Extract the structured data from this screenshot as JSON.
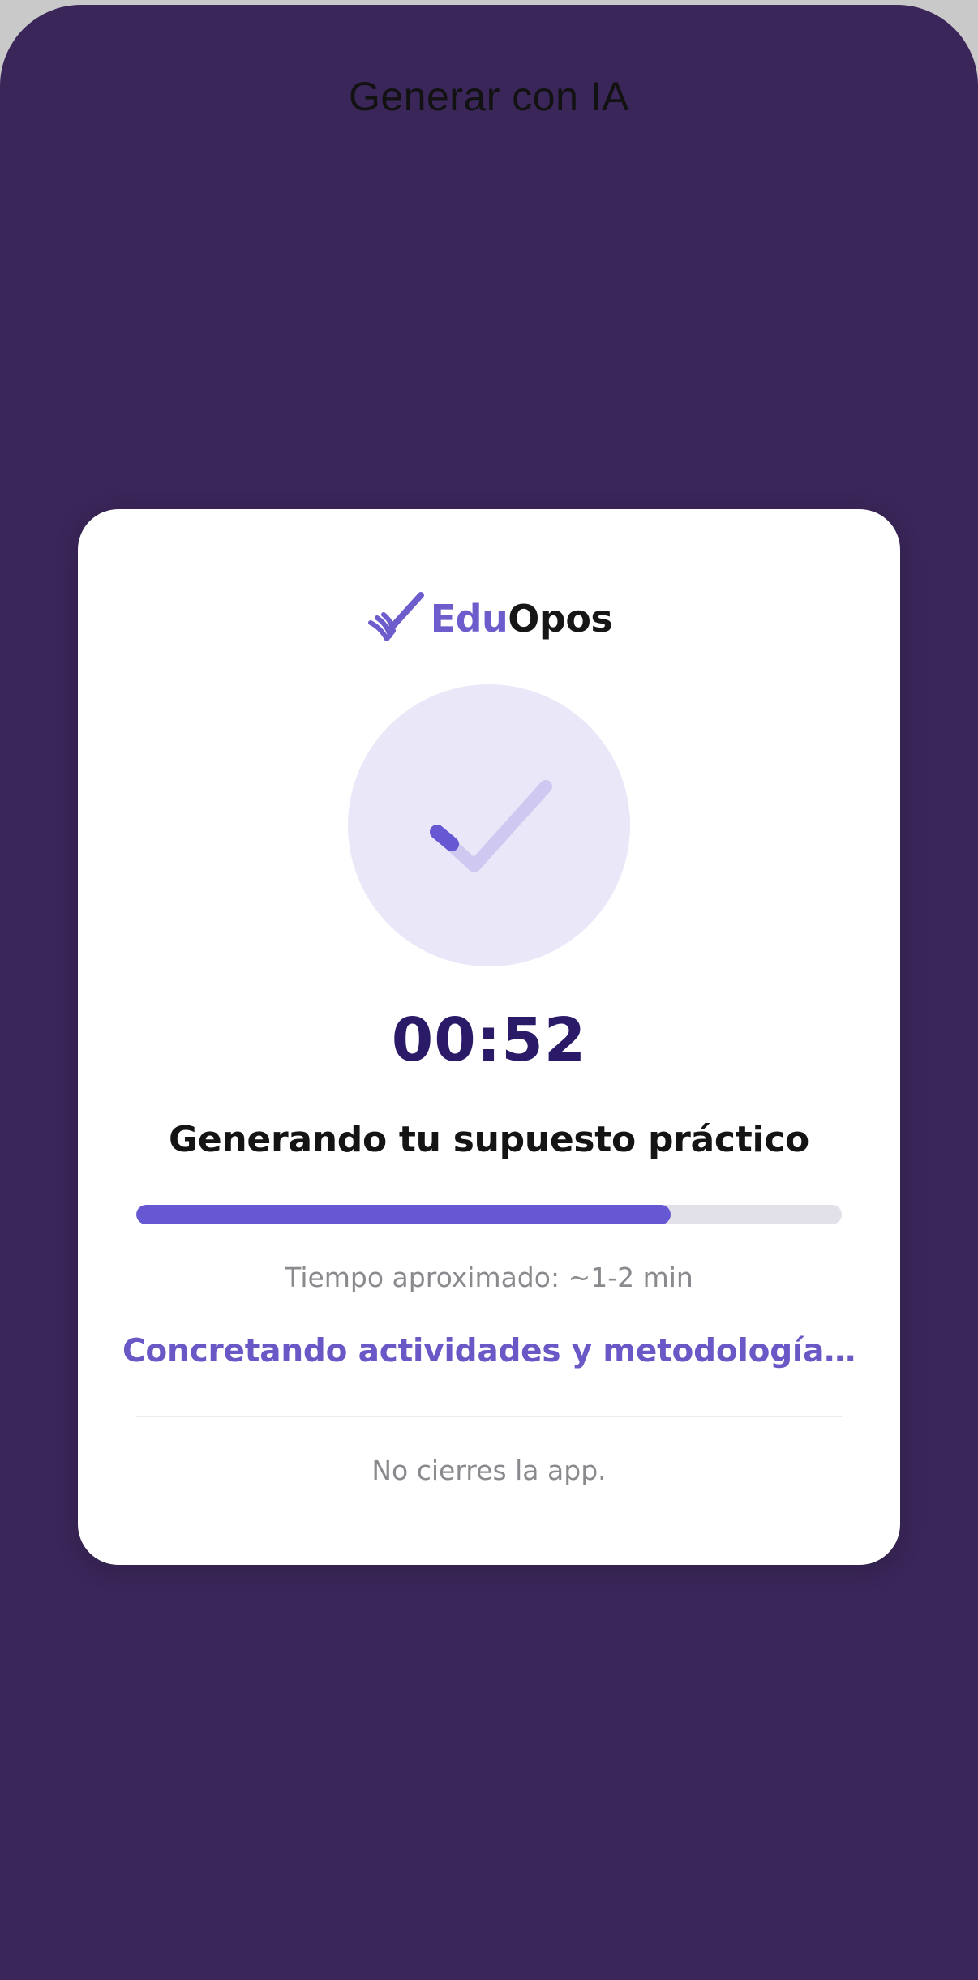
{
  "header": {
    "title": "Generar con IA"
  },
  "card": {
    "logo": {
      "part1": "Edu",
      "part2": "Opos",
      "icon": "checkmark-book-logo"
    },
    "status_icon": "checkmark-icon",
    "timer": "00:52",
    "title": "Generando tu supuesto práctico",
    "progress": 0.757,
    "eta": "Tiempo aproximado: ~1-2 min",
    "step": "Concretando actividades y metodología…",
    "warning": "No cierres la app."
  },
  "colors": {
    "background": "#3a2659",
    "accent": "#6658d3",
    "timer": "#2b1a68",
    "circle": "#e9e7f8"
  }
}
